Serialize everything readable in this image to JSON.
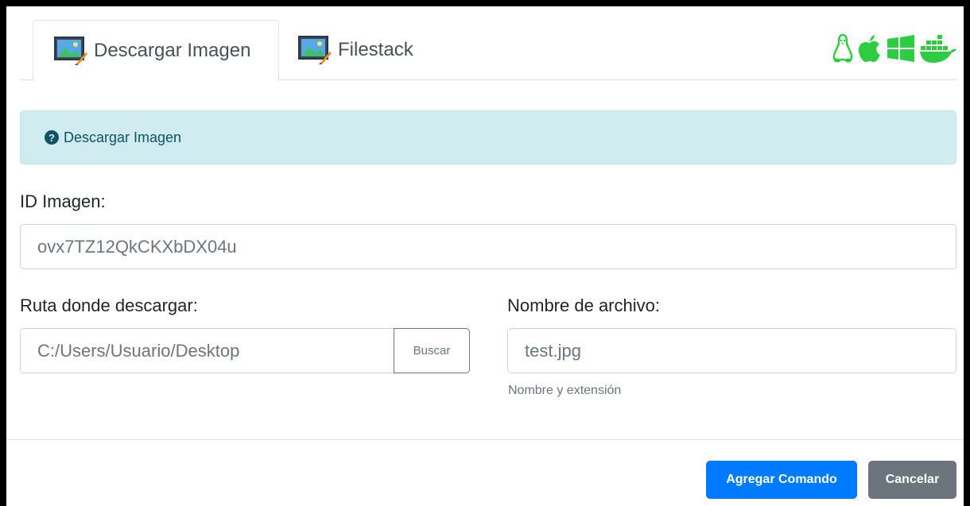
{
  "tabs": [
    {
      "label": "Descargar Imagen",
      "icon": "image-icon",
      "active": true
    },
    {
      "label": "Filestack",
      "icon": "image-icon",
      "active": false
    }
  ],
  "os_icons": [
    "linux-icon",
    "apple-icon",
    "windows-icon",
    "docker-icon"
  ],
  "colors": {
    "os_icons": "#2ecc40",
    "primary": "#007bff",
    "secondary": "#6c757d",
    "info_bg": "#d1ecf1",
    "info_text": "#0c5460"
  },
  "alert": {
    "icon": "question-circle-icon",
    "text": "Descargar Imagen"
  },
  "image_id": {
    "label": "ID Imagen:",
    "value": "ovx7TZ12QkCKXbDX04u"
  },
  "download_path": {
    "label": "Ruta donde descargar:",
    "value": "C:/Users/Usuario/Desktop",
    "button": "Buscar"
  },
  "filename": {
    "label": "Nombre de archivo:",
    "value": "test.jpg",
    "help": "Nombre y extensión"
  },
  "footer": {
    "add_label": "Agregar Comando",
    "cancel_label": "Cancelar"
  }
}
